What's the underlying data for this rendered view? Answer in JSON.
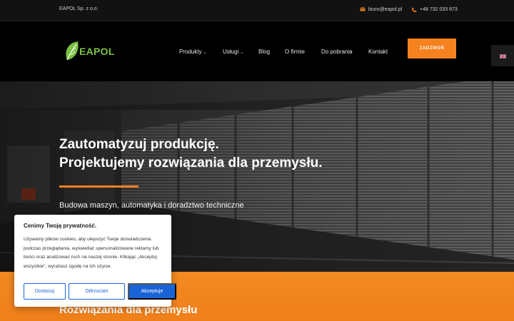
{
  "topbar": {
    "company": "EAPOL Sp. z o.o.",
    "email": "biuro@eapol.pl",
    "phone": "+48 732 033 873",
    "email_icon": "envelope-icon",
    "phone_icon": "phone-icon"
  },
  "header": {
    "logo_text": "EAPOL",
    "nav": [
      {
        "label": "Produkty",
        "has_dropdown": true
      },
      {
        "label": "Usługi",
        "has_dropdown": true
      },
      {
        "label": "Blog",
        "has_dropdown": false
      },
      {
        "label": "O firmie",
        "has_dropdown": false
      },
      {
        "label": "Do pobrania",
        "has_dropdown": false
      },
      {
        "label": "Kontakt",
        "has_dropdown": false
      }
    ],
    "cta_label": "ZADZWOŃ",
    "language_icon": "uk-flag-icon"
  },
  "hero": {
    "title_line1": "Zautomatyzuj produkcję.",
    "title_line2": "Projektujemy rozwiązania dla przemysłu.",
    "subtitle": "Budowa maszyn, automatyka i doradztwo techniczne"
  },
  "section": {
    "title": "Rozwiązania dla przemysłu"
  },
  "cookie": {
    "title": "Cenimy Twoją prywatność.",
    "body": "Używamy plików cookies, aby ulepszyć Twoje doświadczenia podczas przeglądania, wyświetlać spersonalizowane reklamy lub treści oraz analizować ruch na naszej stronie. Klikając „Akceptuj wszystkie”, wyrażasz zgodę na ich użycie.",
    "reject_label": "Dostosuj",
    "customize_label": "Odrzucam",
    "accept_label": "Akceptuje"
  },
  "colors": {
    "accent": "#f5821f",
    "brand_green": "#7bc143",
    "button_blue": "#1a63d6"
  }
}
